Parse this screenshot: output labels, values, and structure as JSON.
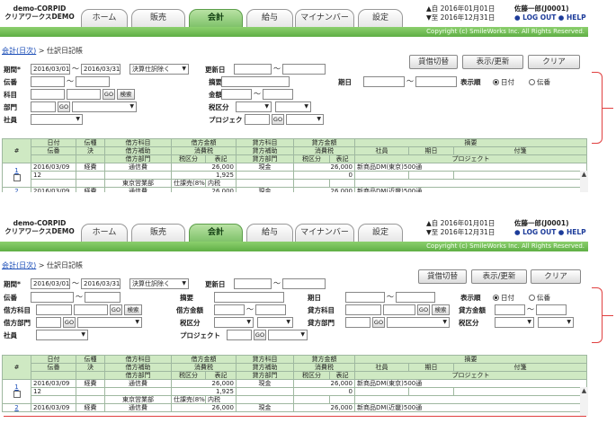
{
  "header": {
    "logo_line1": "demo-CORPID",
    "logo_line2": "クリアワークスDEMO",
    "tabs": [
      "ホーム",
      "販売",
      "会計",
      "給与",
      "マイナンバー",
      "設定"
    ],
    "active_tab": "会計",
    "date_from": "▲自 2016年01月01日",
    "date_to": "▼至 2016年12月31日",
    "user": "佐藤一郎(J0001)",
    "logout": "LOG OUT",
    "help": "HELP",
    "copyright": "Copyright (c) SmileWorks Inc. All Rights Reserved."
  },
  "breadcrumb": {
    "link": "会計(日次)",
    "sep": " > ",
    "current": "仕訳日記帳"
  },
  "buttons": {
    "transfer": "貸借切替",
    "refresh": "表示/更新",
    "clear": "クリア"
  },
  "filters": {
    "period_label": "期間*",
    "period_from": "2016/03/01",
    "period_to": "2016/03/31",
    "period_option": "決算仕訳除く",
    "updated_label": "更新日",
    "slip_label": "伝番",
    "summary_label": "摘要",
    "date_label": "期日",
    "order_label": "表示順",
    "order_date": "日付",
    "order_slip": "伝番",
    "account_label": "科目",
    "amount_label": "金額",
    "dept_label": "部門",
    "tax_label": "税区分",
    "staff_label": "社員",
    "project_label": "プロジェクト",
    "go": "GO",
    "search": "検索",
    "tilde": "～"
  },
  "filters2": {
    "debit_account": "借方科目",
    "debit_amount": "借方金額",
    "credit_account": "貸方科目",
    "credit_amount": "貸方金額",
    "debit_dept": "借方部門",
    "credit_dept": "貸方部門",
    "tax_label": "税区分"
  },
  "table": {
    "h1": [
      "日付",
      "伝種",
      "借方科目",
      "借方金額",
      "貸方科目",
      "貸方金額",
      "摘要"
    ],
    "h2": [
      "伝番",
      "決",
      "借方補助",
      "消費税",
      "貸方補助",
      "消費税",
      "社員",
      "期日",
      "付箋"
    ],
    "h3": [
      "借方部門",
      "税区分",
      "表記",
      "貸方部門",
      "税区分",
      "表記",
      "プロジェクト"
    ],
    "num_col": "#",
    "row": {
      "no": "1",
      "date": "2016/03/09",
      "type": "経費",
      "debit": "通信費",
      "debit_amt": "26,000",
      "credit": "現金",
      "credit_amt": "26,000",
      "summary": "新商品DM(東京)500通",
      "slip": "12",
      "tax": "1,925",
      "credit_tax": "0",
      "dept": "東京営業部",
      "taxkind": "仕課売(8%)",
      "taxnote": "内税"
    },
    "row2": {
      "no": "2",
      "date": "2016/03/09",
      "type": "経費",
      "debit": "通信費",
      "debit_amt": "26,000",
      "credit": "現金",
      "credit_amt": "26,000",
      "summary": "新商品DM(近畿)500通"
    }
  }
}
